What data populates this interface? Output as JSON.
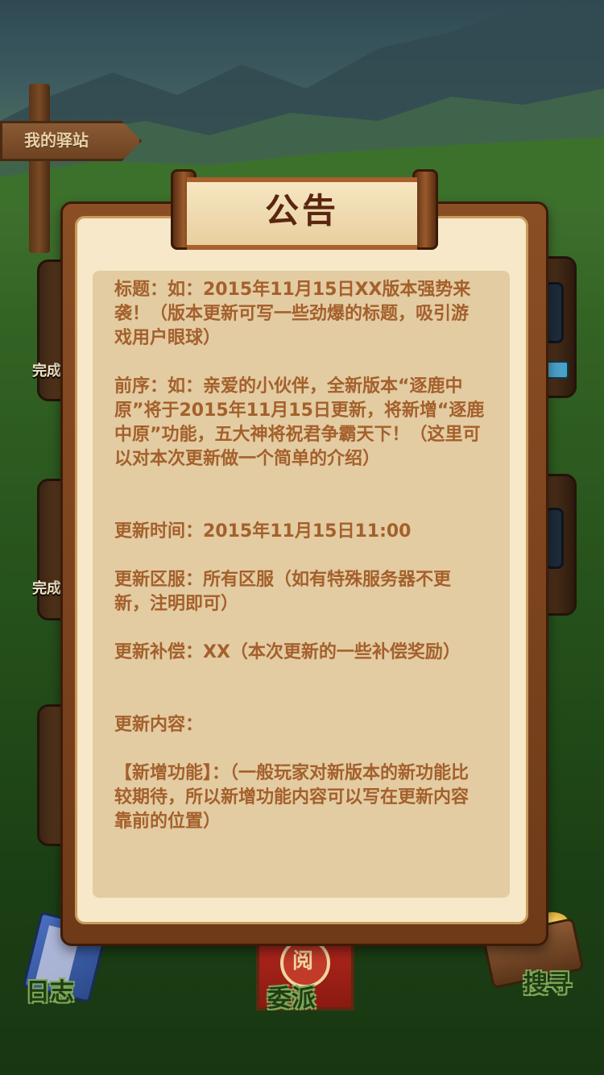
{
  "scene": {
    "signpost_label": "我的驿站",
    "done_labels": [
      "完成",
      "完成"
    ]
  },
  "nav": {
    "journal": "日志",
    "dispatch": "委派",
    "dispatch_emblem": "阅",
    "search": "搜寻"
  },
  "dialog": {
    "title": "公告",
    "paragraphs": [
      "标题：如：2015年11月15日XX版本强势来袭！（版本更新可写一些劲爆的标题，吸引游戏用户眼球）",
      "前序：如：亲爱的小伙伴，全新版本“逐鹿中原”将于2015年11月15日更新，将新增“逐鹿中原”功能，五大神将祝君争霸天下！（这里可以对本次更新做一个简单的介绍）",
      "更新时间：2015年11月15日11:00",
      "更新区服：所有区服（如有特殊服务器不更新，注明即可）",
      "更新补偿：XX（本次更新的一些补偿奖励）",
      "更新内容：",
      "【新增功能】：（一般玩家对新版本的新功能比较期待，所以新增功能内容可以写在更新内容靠前的位置）"
    ]
  },
  "colors": {
    "text_brown": "#a4602c",
    "title_brown": "#5a2610",
    "panel": "#e3cca2",
    "frame": "#7a4420"
  }
}
